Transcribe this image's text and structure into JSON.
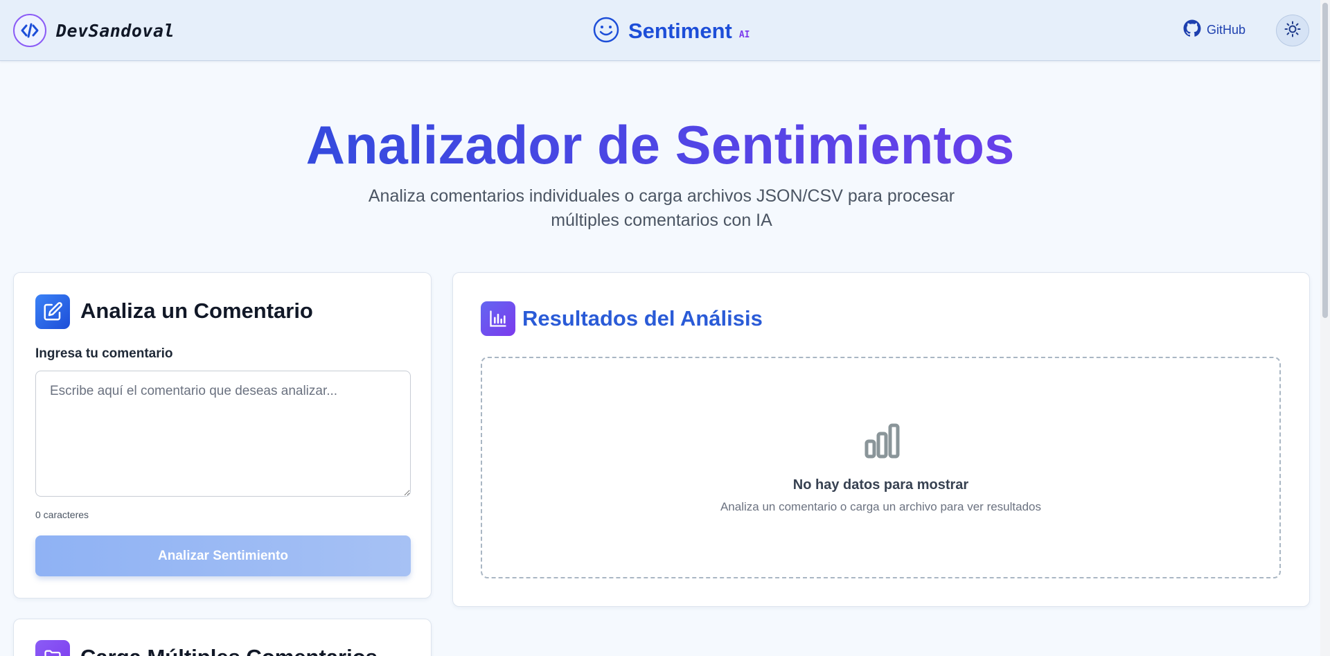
{
  "header": {
    "brand_name": "DevSandoval",
    "app_title": "Sentiment",
    "app_badge": "AI",
    "github_label": "GitHub",
    "theme_toggle_icon": "sun-icon"
  },
  "hero": {
    "title": "Analizador de Sentimientos",
    "subtitle": "Analiza comentarios individuales o carga archivos JSON/CSV para procesar múltiples comentarios con IA"
  },
  "single_card": {
    "title": "Analiza un Comentario",
    "icon": "edit-icon",
    "field_label": "Ingresa tu comentario",
    "input_value": "",
    "input_placeholder": "Escribe aquí el comentario que deseas analizar...",
    "char_count": "0 caracteres",
    "submit_label": "Analizar Sentimiento"
  },
  "results_card": {
    "title": "Resultados del Análisis",
    "icon": "bar-chart-icon",
    "empty_icon": "bar-chart-outline-icon",
    "empty_title": "No hay datos para mostrar",
    "empty_subtitle": "Analiza un comentario o carga un archivo para ver resultados"
  },
  "multi_card": {
    "title": "Carga Múltiples Comentarios",
    "icon": "folder-icon"
  },
  "colors": {
    "primary": "#1d4ed8",
    "accent": "#7c3aed",
    "header_bg": "#e6effa",
    "button_disabled": "#9dbbf4"
  }
}
